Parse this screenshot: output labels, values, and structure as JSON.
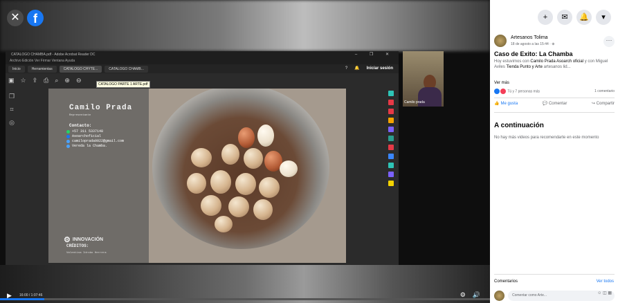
{
  "player": {
    "close_icon": "✕",
    "fb_logo": "f",
    "time": "16:00 / 1:07:46",
    "progress": 0.09
  },
  "share": {
    "window_title": "CATALOGO CHAMBA.pdf - Adobe Acrobat Reader DC",
    "menu": "Archivo  Edición  Ver  Firmar  Ventana  Ayuda",
    "tabs": [
      "Inicio",
      "Herramientas",
      "CATALOGO CHYTE...",
      "CATALOGO CHAMB..."
    ],
    "signin": "Iniciar sesión",
    "tooltip": "CATALOGO PARTE 1 ARTE.pdf",
    "card": {
      "name": "Camilo Prada",
      "role": "Representante",
      "contact_label": "Contacto:",
      "phone": "+57 311 5337148",
      "social": "Asoarchoficial",
      "email": "camiloprada0022@gmail.com",
      "location": "Vereda la Chamba.",
      "credits_label": "CRÉDITOS:",
      "credit_name": "Valentina Idrobo Herrera",
      "innov": "INNOVACIÓN"
    },
    "camera_label": "Camilo prada"
  },
  "sidebar": {
    "page_name": "Artesanos Tolima",
    "post_date": "18 de agosto a las 15:44 · ⊕",
    "more": "···",
    "title": "Caso de Exito: La Chamba",
    "body_1": "Hoy estuvimos con ",
    "body_link_1": "Camilo Prada Asoarch oficial",
    "body_2": " y con Miguel Aviles ",
    "body_link_2": "Tienda Punto y Arte",
    "body_3": " artesanos lid...",
    "see_more": "Ver más",
    "reactions": "Tú y 7 personas más",
    "comments_count": "1 comentario",
    "like": "Me gusta",
    "comment": "Comentar",
    "share": "Compartir",
    "next_title": "A continuación",
    "next_empty": "No hay más videos para recomendarte en este momento",
    "comments_hdr": "Comentarios",
    "see_all": "Ver todos",
    "comment_placeholder": "Comentar como Arte..."
  }
}
